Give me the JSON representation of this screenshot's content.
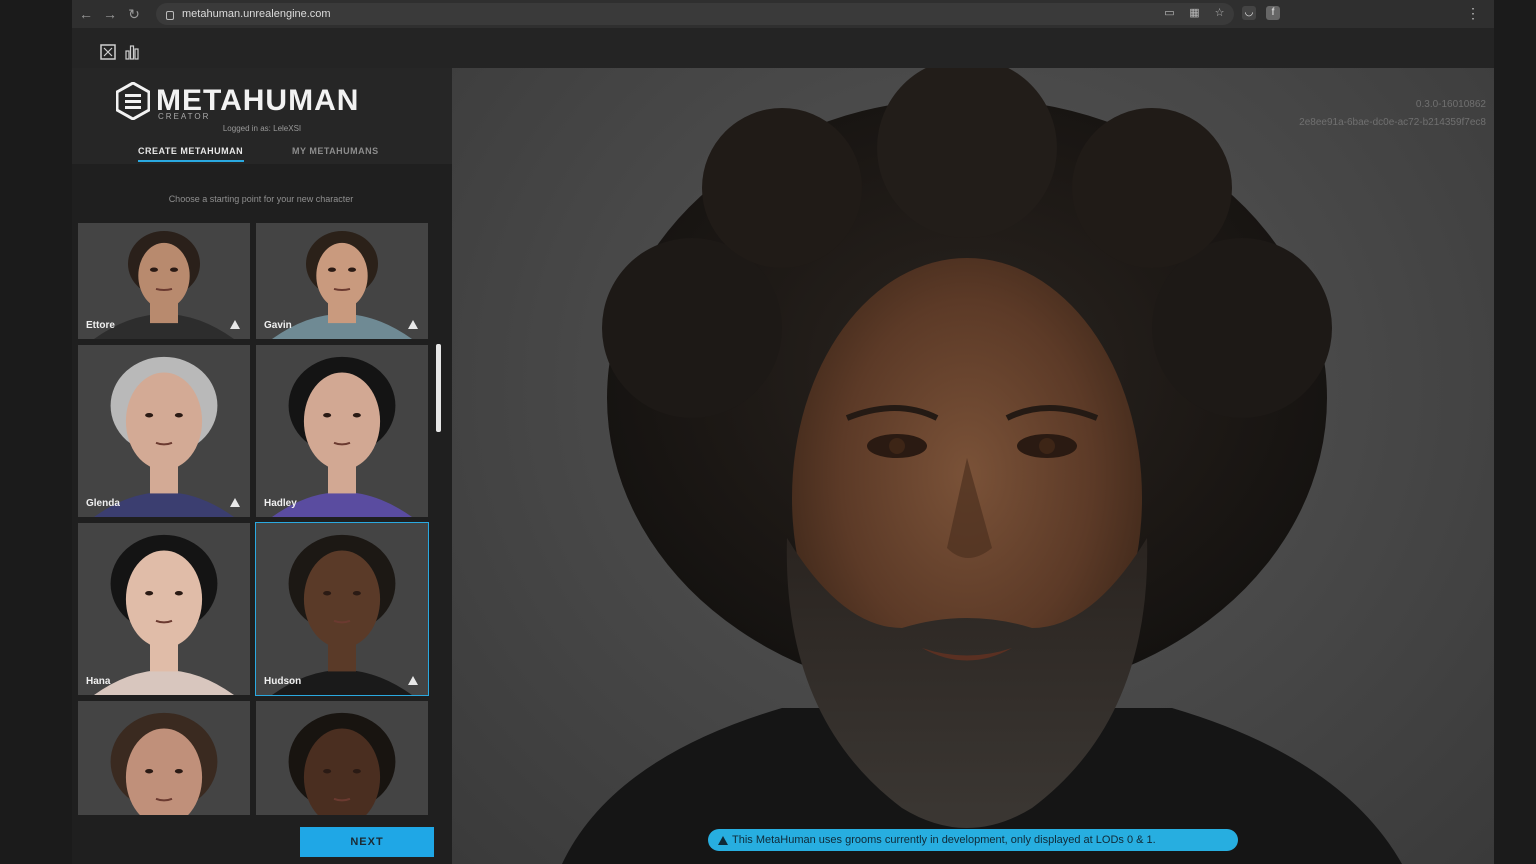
{
  "browser": {
    "url": "metahuman.unrealengine.com",
    "back_icon": "←",
    "forward_icon": "→",
    "reload_icon": "↻",
    "menu_icon": "⋮"
  },
  "app": {
    "logo_text": "METAHUMAN",
    "logo_sub": "CREATOR",
    "logged_in": "Logged in as: LeleXSI",
    "tabs": [
      {
        "label": "CREATE METAHUMAN",
        "active": true
      },
      {
        "label": "MY METAHUMANS",
        "active": false
      }
    ],
    "choose_prompt": "Choose a starting point for your new character",
    "next_label": "NEXT",
    "accent_color": "#2aa9e0"
  },
  "presets": [
    {
      "name": "Ettore",
      "warning": true,
      "skin": "#b88a6e",
      "hair": "#2a201a",
      "shirt": "#2d2d2d"
    },
    {
      "name": "Gavin",
      "warning": true,
      "skin": "#c99a7e",
      "hair": "#2b2119",
      "shirt": "#6f8a94"
    },
    {
      "name": "Glenda",
      "warning": true,
      "skin": "#d3aa95",
      "hair": "#b9b9b9",
      "shirt": "#3b3e70"
    },
    {
      "name": "Hadley",
      "warning": false,
      "skin": "#d2a893",
      "hair": "#141414",
      "shirt": "#5a4ca0"
    },
    {
      "name": "Hana",
      "warning": false,
      "skin": "#e0bca8",
      "hair": "#141414",
      "shirt": "#d8c6be"
    },
    {
      "name": "Hudson",
      "warning": true,
      "skin": "#5a3a28",
      "hair": "#1c1814",
      "shirt": "#1a1a1a"
    },
    {
      "name": "",
      "warning": false,
      "skin": "#c0907a",
      "hair": "#3a2a20",
      "shirt": "#3e3e3e"
    },
    {
      "name": "",
      "warning": false,
      "skin": "#4a2e20",
      "hair": "#181410",
      "shirt": "#3e3e3e"
    }
  ],
  "selected_preset": "Hudson",
  "viewport": {
    "version": "0.3.0-16010862",
    "build_id": "2e8ee91a-6bae-dc0e-ac72-b214359f7ec8",
    "notice": "This MetaHuman uses grooms currently in development, only displayed at LODs 0 & 1."
  }
}
